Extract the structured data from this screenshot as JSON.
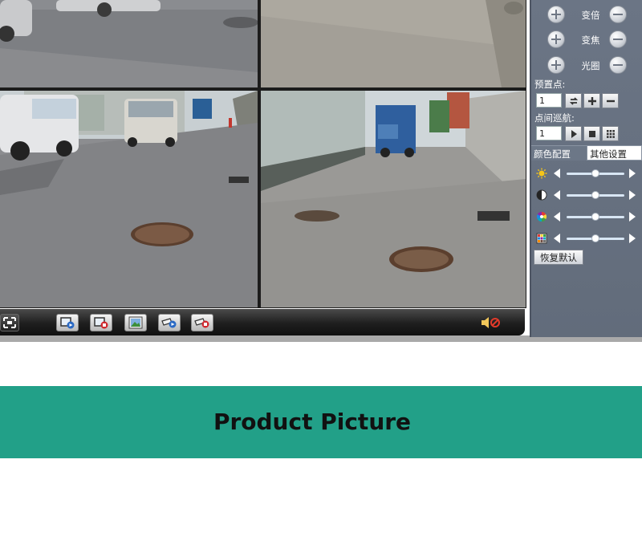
{
  "ptz": {
    "zoom_label": "变倍",
    "focus_label": "变焦",
    "iris_label": "光圈"
  },
  "preset": {
    "label": "预置点:",
    "value": "1"
  },
  "cruise": {
    "label": "点间巡航:",
    "value": "1"
  },
  "tabs": {
    "color": "颜色配置",
    "other": "其他设置"
  },
  "sliders": {
    "brightness": 0.5,
    "contrast": 0.5,
    "saturation": 0.5,
    "hue": 0.5
  },
  "restore_label": "恢复默认",
  "banner": {
    "title": "Product Picture"
  },
  "colors": {
    "panel": "#66707f",
    "banner": "#22a088",
    "toolbar": "#1e1e1e"
  },
  "icons": [
    "fullscreen-icon",
    "record-start-icon",
    "record-stop-icon",
    "snapshot-icon",
    "camera-play-icon",
    "camera-stop-icon",
    "mute-icon",
    "sun-icon",
    "contrast-icon",
    "color-wheel-icon",
    "hue-grid-icon",
    "refresh-icon",
    "plus-icon",
    "minus-icon",
    "play-icon",
    "stop-icon",
    "grid-icon"
  ]
}
